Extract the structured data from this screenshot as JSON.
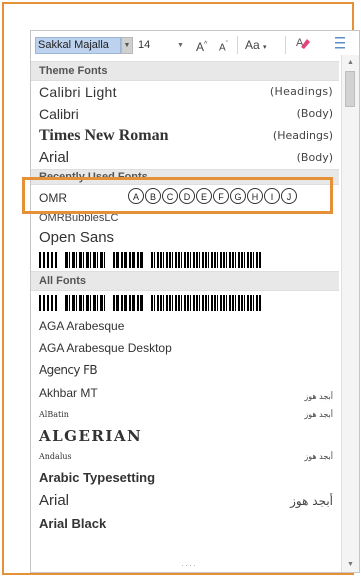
{
  "toolbar": {
    "font_name": "Sakkal Majalla",
    "font_size": "14",
    "grow_label": "A",
    "shrink_label": "A",
    "case_label": "Aa"
  },
  "sections": {
    "theme": "Theme Fonts",
    "recent": "Recently Used Fonts",
    "all": "All Fonts"
  },
  "theme_fonts": [
    {
      "name": "Calibri Light",
      "tag": "(Headings)"
    },
    {
      "name": "Calibri",
      "tag": "(Body)"
    },
    {
      "name": "Times New Roman",
      "tag": "(Headings)"
    },
    {
      "name": "Arial",
      "tag": "(Body)"
    }
  ],
  "recent_fonts": {
    "omr": "OMR",
    "omr_bubbles": [
      "A",
      "B",
      "C",
      "D",
      "E",
      "F",
      "G",
      "H",
      "I",
      "J"
    ],
    "bubble_lc": "OMRBubblesLC",
    "open_sans": "Open Sans"
  },
  "all_fonts": [
    {
      "name": "AGA Arabesque",
      "tag": ""
    },
    {
      "name": "AGA Arabesque Desktop",
      "tag": ""
    },
    {
      "name": "Agency FB",
      "tag": ""
    },
    {
      "name": "Akhbar MT",
      "tag": "أبجد هوز"
    },
    {
      "name": "AlBatin",
      "tag": "أبجد هوز"
    },
    {
      "name": "ALGERIAN",
      "tag": ""
    },
    {
      "name": "Andalus",
      "tag": "أبجد هوز"
    },
    {
      "name": "Arabic Typesetting",
      "tag": ""
    },
    {
      "name": "Arial",
      "tag": "أبجد هوز"
    },
    {
      "name": "Arial Black",
      "tag": ""
    }
  ],
  "colors": {
    "highlight": "#e69138",
    "selected_font_bg": "#bcd2ee"
  }
}
